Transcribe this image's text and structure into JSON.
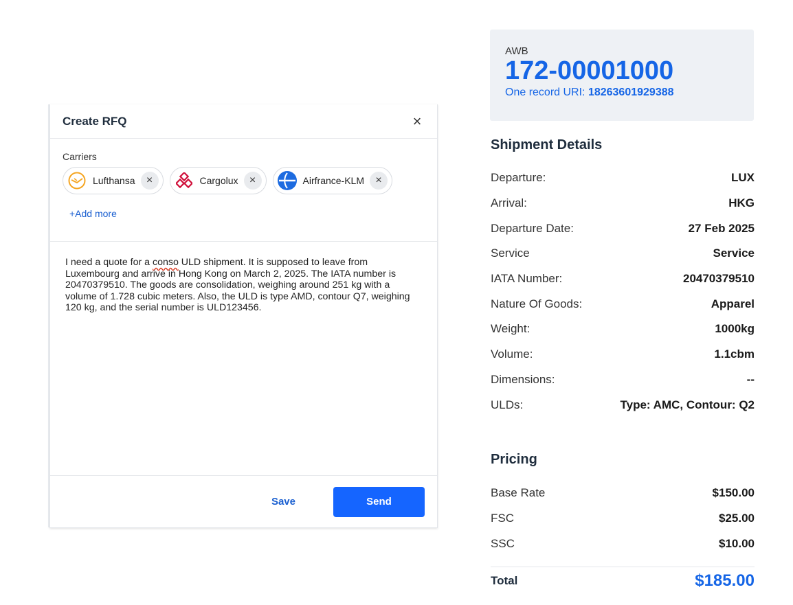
{
  "rfq": {
    "title": "Create RFQ",
    "close_label": "×",
    "carriers_label": "Carriers",
    "carriers": [
      {
        "name": "Lufthansa",
        "icon": "lufthansa-logo-icon",
        "color": "#f5a623"
      },
      {
        "name": "Cargolux",
        "icon": "cargolux-logo-icon",
        "color": "#d0103a"
      },
      {
        "name": "Airfrance-KLM",
        "icon": "airfrance-klm-logo-icon",
        "color": "#1d6be0"
      }
    ],
    "remove_label": "×",
    "add_more_label": "+Add more",
    "message_before": "I need a quote for a ",
    "message_misspelled": "conso",
    "message_after": " ULD shipment. It is supposed to leave from Luxembourg and arrive in Hong Kong on March 2, 2025. The IATA number is 20470379510. The goods are consolidation, weighing around 251 kg with a volume of 1.728 cubic meters. Also, the ULD is type AMD, contour Q7, weighing 120 kg, and the serial number is ULD123456.",
    "save_label": "Save",
    "send_label": "Send"
  },
  "awb": {
    "label": "AWB",
    "number": "172-00001000",
    "uri_label": "One record URI: ",
    "uri_value": "18263601929388"
  },
  "shipment": {
    "heading": "Shipment Details",
    "rows": [
      {
        "key": "Departure:",
        "value": "LUX"
      },
      {
        "key": "Arrival:",
        "value": "HKG"
      },
      {
        "key": "Departure Date:",
        "value": "27 Feb 2025"
      },
      {
        "key": "Service",
        "value": "Service"
      },
      {
        "key": "IATA Number:",
        "value": "20470379510"
      },
      {
        "key": "Nature Of Goods:",
        "value": "Apparel"
      },
      {
        "key": "Weight:",
        "value": "1000kg"
      },
      {
        "key": "Volume:",
        "value": "1.1cbm"
      },
      {
        "key": "Dimensions:",
        "value": "--"
      },
      {
        "key": "ULDs:",
        "value": "Type: AMC, Contour: Q2"
      }
    ]
  },
  "pricing": {
    "heading": "Pricing",
    "rows": [
      {
        "key": "Base Rate",
        "value": "$150.00"
      },
      {
        "key": "FSC",
        "value": "$25.00"
      },
      {
        "key": "SSC",
        "value": "$10.00"
      }
    ],
    "total_label": "Total",
    "total_value": "$185.00"
  },
  "colors": {
    "accent": "#1565e6",
    "send_button": "#1565ff",
    "card_background": "#eef1f5"
  }
}
